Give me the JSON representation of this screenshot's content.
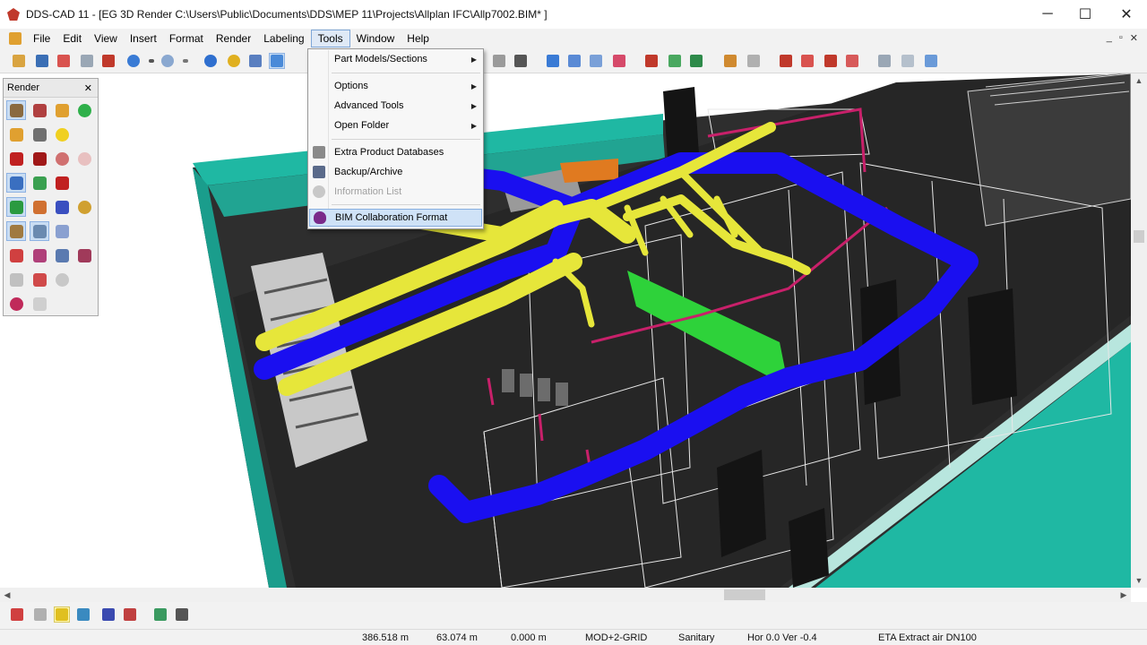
{
  "window": {
    "title": "DDS-CAD 11 - [EG  3D  Render  C:\\Users\\Public\\Documents\\DDS\\MEP 11\\Projects\\Allplan IFC\\Allp7002.BIM* ]",
    "minimize": "─",
    "maximize": "☐",
    "close": "✕"
  },
  "menubar": {
    "items": [
      "File",
      "Edit",
      "View",
      "Insert",
      "Format",
      "Render",
      "Labeling",
      "Tools",
      "Window",
      "Help"
    ],
    "active": "Tools",
    "mdi_controls": [
      "_",
      "▫",
      "✕"
    ]
  },
  "render_panel": {
    "title": "Render",
    "close": "✕"
  },
  "tools_menu": {
    "items": [
      {
        "label": "Part Models/Sections",
        "submenu": true,
        "enabled": true,
        "icon": "none"
      },
      {
        "label": "Options",
        "submenu": true,
        "enabled": true,
        "icon": "none"
      },
      {
        "label": "Advanced Tools",
        "submenu": true,
        "enabled": true,
        "icon": "none"
      },
      {
        "label": "Open Folder",
        "submenu": true,
        "enabled": true,
        "icon": "none"
      },
      {
        "label": "Extra Product Databases",
        "submenu": false,
        "enabled": true,
        "icon": "database-icon"
      },
      {
        "label": "Backup/Archive",
        "submenu": false,
        "enabled": true,
        "icon": "archive-icon"
      },
      {
        "label": "Information List",
        "submenu": false,
        "enabled": false,
        "icon": "info-icon"
      },
      {
        "label": "BIM Collaboration Format",
        "submenu": false,
        "enabled": true,
        "icon": "bcf-icon",
        "highlighted": true
      }
    ],
    "submenu_arrow": "▶"
  },
  "scrollbars": {
    "up": "▲",
    "down": "▼",
    "left": "◀",
    "right": "▶"
  },
  "statusbar": {
    "x": "386.518 m",
    "y": "63.074 m",
    "z": "0.000 m",
    "mode": "MOD+2-GRID",
    "discipline": "Sanitary",
    "angles": "Hor  0.0 Ver  -0.4",
    "object": "ETA Extract air DN100"
  },
  "colors": {
    "duct_blue": "#1a0ff0",
    "pipe_yellow": "#e6e63a",
    "wall_teal": "#1fb8a3",
    "floor_dark": "#2a2a2a",
    "menu_highlight": "#cfe2f7"
  }
}
